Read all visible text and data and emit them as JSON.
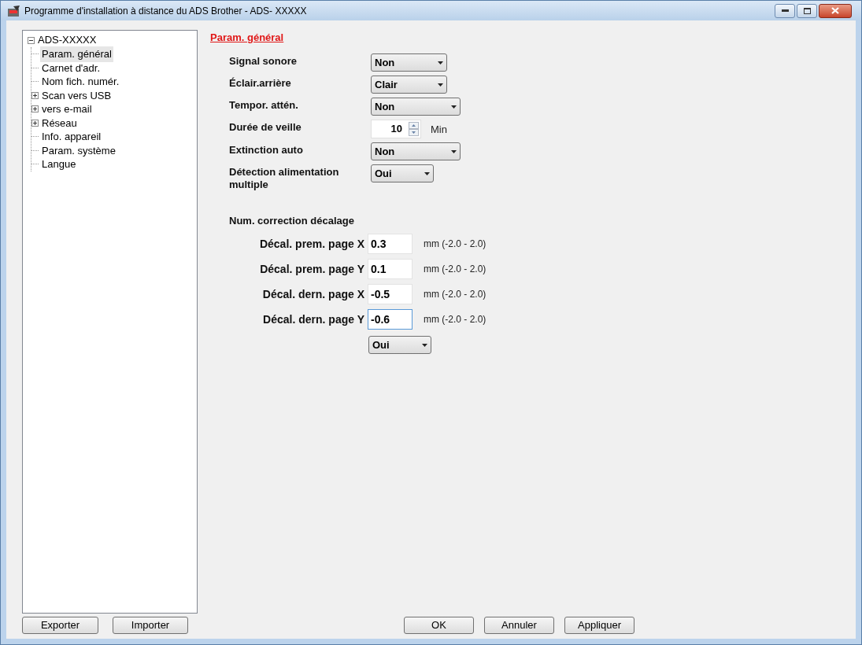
{
  "window": {
    "title": "Programme d'installation à distance du ADS Brother - ADS- XXXXX"
  },
  "tree": {
    "label": "ADS-XXXXX",
    "expanded": true,
    "children": [
      {
        "label": "Param. général",
        "kind": "leaf",
        "selected": true
      },
      {
        "label": "Carnet d'adr.",
        "kind": "leaf",
        "selected": false
      },
      {
        "label": "Nom fich. numér.",
        "kind": "leaf",
        "selected": false
      },
      {
        "label": "Scan vers USB",
        "kind": "folder",
        "expanded": false,
        "selected": false
      },
      {
        "label": "vers e-mail",
        "kind": "folder",
        "expanded": false,
        "selected": false
      },
      {
        "label": "Réseau",
        "kind": "folder",
        "expanded": false,
        "selected": false
      },
      {
        "label": "Info. appareil",
        "kind": "leaf",
        "selected": false
      },
      {
        "label": "Param. système",
        "kind": "leaf",
        "selected": false
      },
      {
        "label": "Langue",
        "kind": "leaf",
        "selected": false
      }
    ]
  },
  "section_title": "Param. général",
  "settings": [
    {
      "kind": "dropdown",
      "label": "Signal sonore",
      "value": "Non"
    },
    {
      "kind": "dropdown",
      "label": "Éclair.arrière",
      "value": "Clair"
    },
    {
      "kind": "dropdown",
      "label": "Tempor. attén.",
      "value": "Non"
    },
    {
      "kind": "spinner",
      "label": "Durée de veille",
      "value": "10",
      "unit": "Min"
    },
    {
      "kind": "dropdown",
      "label": "Extinction auto",
      "value": "Non"
    },
    {
      "kind": "dropdown",
      "label": "Détection alimentation multiple",
      "value": "Oui"
    }
  ],
  "offset_heading": "Num. correction décalage",
  "offsets": [
    {
      "label": "Décal. prem. page X",
      "value": "0.3",
      "range": "mm (-2.0 - 2.0)",
      "focused": false
    },
    {
      "label": "Décal. prem. page Y",
      "value": "0.1",
      "range": "mm (-2.0 - 2.0)",
      "focused": false
    },
    {
      "label": "Décal. dern. page X",
      "value": "-0.5",
      "range": "mm (-2.0 - 2.0)",
      "focused": false
    },
    {
      "label": "Décal. dern. page Y",
      "value": "-0.6",
      "range": "mm (-2.0 - 2.0)",
      "focused": true
    }
  ],
  "offset_dropdown": {
    "value": "Oui"
  },
  "footer_left": [
    "Exporter",
    "Importer"
  ],
  "footer_right": [
    "OK",
    "Annuler",
    "Appliquer"
  ]
}
